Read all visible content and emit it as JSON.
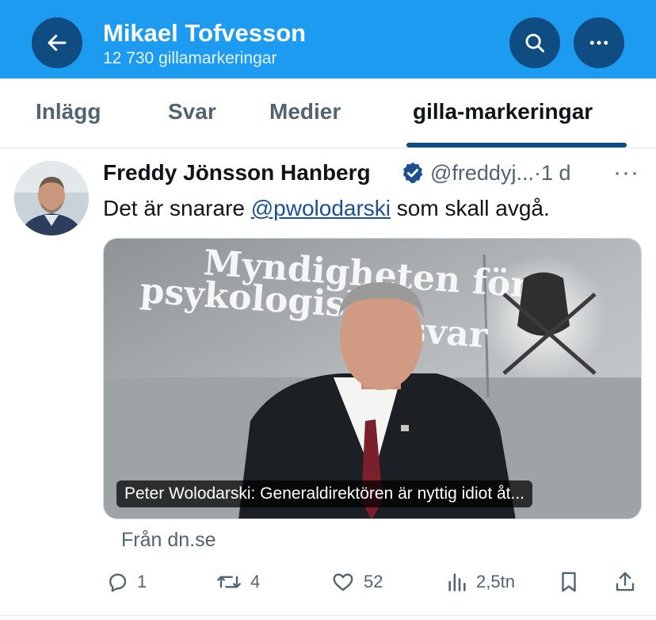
{
  "header": {
    "title": "Mikael Tofvesson",
    "subtitle": "12 730 gillamarkeringar",
    "back_icon": "arrow-left-icon",
    "search_icon": "search-icon",
    "more_icon": "more-horizontal-icon",
    "background_color": "#1d9bf0",
    "button_color": "#0f4c81"
  },
  "tabs": [
    {
      "label": "Inlägg",
      "active": false
    },
    {
      "label": "Svar",
      "active": false
    },
    {
      "label": "Medier",
      "active": false
    },
    {
      "label": "gilla-markeringar",
      "active": true
    }
  ],
  "tweet": {
    "author_name": "Freddy Jönsson Hanberg",
    "verified": true,
    "handle": "@freddyj...",
    "separator": "·",
    "time": "1 d",
    "more_label": "···",
    "text_before": "Det är snarare ",
    "mention": "@pwolodarski",
    "text_after": " som skall avgå.",
    "card": {
      "image_text_line1": "Myndigheten för",
      "image_text_line2": "psykologiskt",
      "image_text_line3": "försvar",
      "caption": "Peter Wolodarski: Generaldirektören är nyttig idiot åt...",
      "source": "Från dn.se"
    },
    "actions": {
      "replies": "1",
      "reposts": "4",
      "likes": "52",
      "views": "2,5tn"
    }
  }
}
